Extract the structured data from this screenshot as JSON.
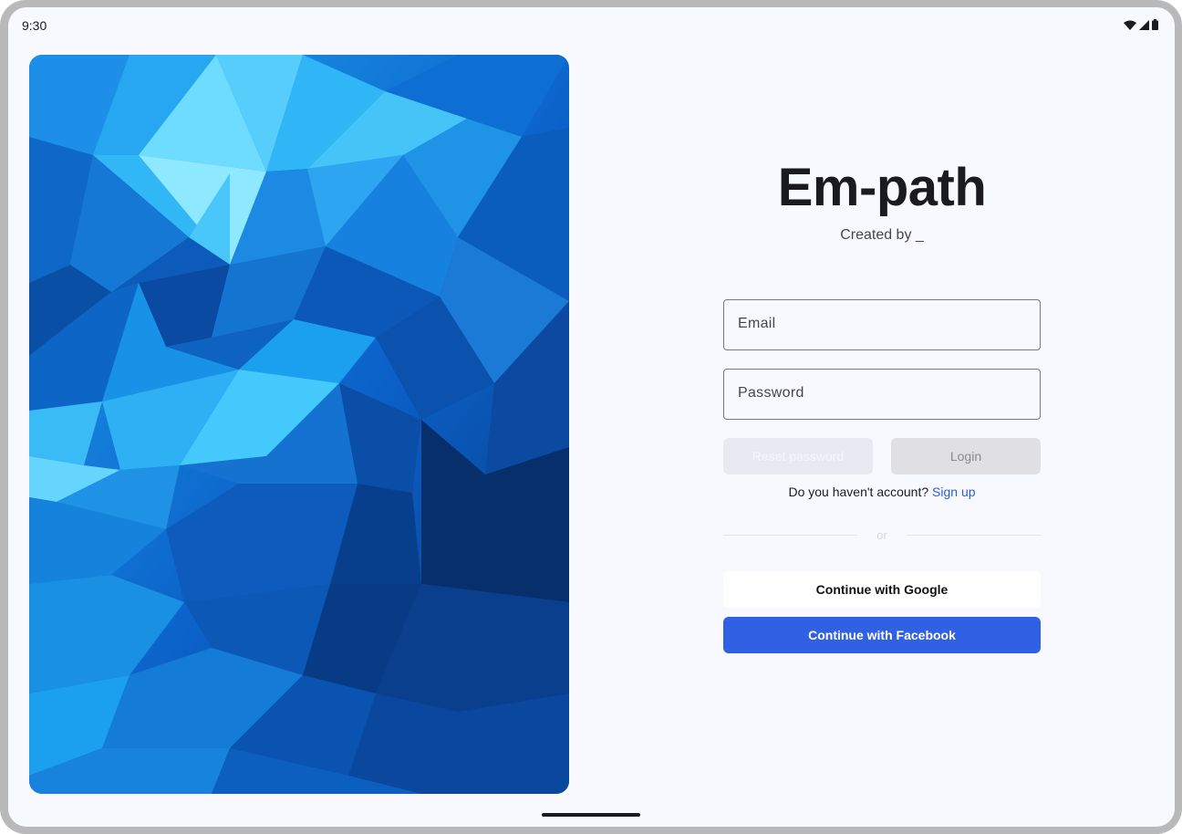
{
  "status_bar": {
    "time": "9:30"
  },
  "app": {
    "title": "Em-path",
    "subtitle": "Created by _"
  },
  "form": {
    "email_placeholder": "Email",
    "password_placeholder": "Password",
    "reset_label": "Reset password",
    "login_label": "Login",
    "signup_prompt": "Do you haven't account?",
    "signup_link": "Sign up",
    "divider_label": "or",
    "google_label": "Continue with Google",
    "facebook_label": "Continue with Facebook"
  },
  "icons": {
    "wifi": "wifi-icon",
    "signal": "signal-icon",
    "battery": "battery-icon"
  },
  "colors": {
    "accent": "#3060e4",
    "link": "#2e5bd8",
    "background": "#f8f9ff"
  }
}
